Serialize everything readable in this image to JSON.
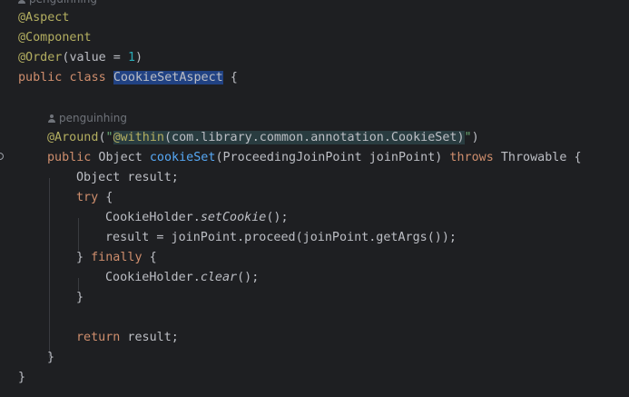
{
  "hints": {
    "top_author": "penguinhing",
    "method_author": "penguinhing"
  },
  "code": {
    "l1": {
      "annotation": "@Aspect"
    },
    "l2": {
      "annotation": "@Component"
    },
    "l3": {
      "annotation": "@Order",
      "open": "(",
      "param": "value",
      "eq": " = ",
      "value": "1",
      "close": ")"
    },
    "l4": {
      "kw_public": "public",
      "kw_class": "class",
      "class_name": "CookieSetAspect",
      "brace": " {"
    },
    "l6": {
      "annotation": "@Around",
      "open": "(",
      "quote_open": "\"",
      "pointcut_designator": "@within",
      "pointcut_arg": "(com.library.common.annotation.CookieSet)",
      "quote_close": "\"",
      "close": ")"
    },
    "l7": {
      "kw_public": "public",
      "return_type": " Object ",
      "method_name": "cookieSet",
      "params": "(ProceedingJoinPoint joinPoint) ",
      "kw_throws": "throws",
      "exception": " Throwable {"
    },
    "l8": {
      "text": "Object result;"
    },
    "l9": {
      "kw_try": "try",
      "brace": " {"
    },
    "l10": {
      "class": "CookieHolder.",
      "method": "setCookie",
      "rest": "();"
    },
    "l11": {
      "text": "result = joinPoint.proceed(joinPoint.getArgs());"
    },
    "l12": {
      "close": "} ",
      "kw_finally": "finally",
      "brace": " {"
    },
    "l13": {
      "class": "CookieHolder.",
      "method": "clear",
      "rest": "();"
    },
    "l14": {
      "text": "}"
    },
    "l16": {
      "kw_return": "return",
      "rest": " result;"
    },
    "l17": {
      "text": "}"
    },
    "l18": {
      "text": "}"
    }
  },
  "colors": {
    "background": "#1e1f22",
    "text": "#bcbec4",
    "keyword": "#cf8e6d",
    "annotation": "#b3ae60",
    "function": "#56a8f5",
    "number": "#2aacb8",
    "string": "#6aab73",
    "selection": "#214283",
    "hint": "#6f737a"
  }
}
